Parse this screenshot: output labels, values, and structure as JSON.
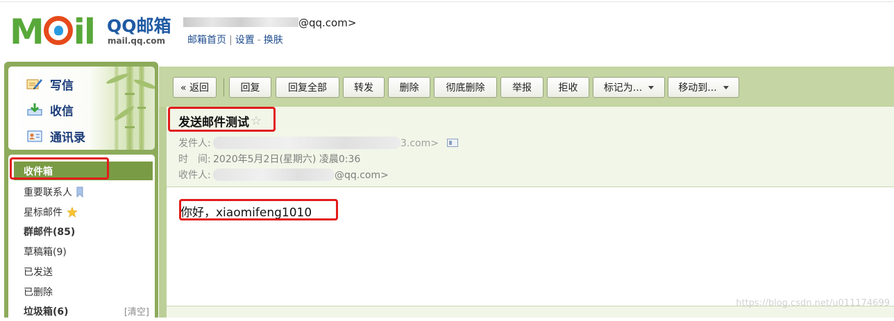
{
  "header": {
    "logo_text": "MOil",
    "product_name": "QQ邮箱",
    "domain": "mail.qq.com",
    "user_email_suffix": "@qq.com>",
    "links": [
      "邮箱首页",
      "设置",
      "换肤"
    ]
  },
  "sidebar": {
    "quick_actions": [
      {
        "label": "写信",
        "icon": "compose-icon"
      },
      {
        "label": "收信",
        "icon": "receive-icon"
      },
      {
        "label": "通讯录",
        "icon": "contacts-icon"
      }
    ],
    "folders": [
      {
        "label": "收件箱",
        "active": true
      },
      {
        "label": "重要联系人",
        "icon": "bookmark-icon"
      },
      {
        "label": "星标邮件",
        "icon": "star-icon"
      },
      {
        "label": "群邮件(85)",
        "bold": true
      },
      {
        "label": "草稿箱(9)"
      },
      {
        "label": "已发送"
      },
      {
        "label": "已删除"
      },
      {
        "label": "垃圾箱(6)",
        "bold": true,
        "action": "[清空]"
      }
    ]
  },
  "toolbar": {
    "buttons": [
      "« 返回",
      "回复",
      "回复全部",
      "转发",
      "删除",
      "彻底删除",
      "举报",
      "拒收",
      "标记为...",
      "移动到..."
    ]
  },
  "mail": {
    "subject": "发送邮件测试",
    "from_label": "发件人:",
    "from_value_suffix": "3.com>",
    "time_label": "时　间:",
    "time_value": "2020年5月2日(星期六) 凌晨0:36",
    "to_label": "收件人:",
    "to_value_suffix": "@qq.com>",
    "body": "你好，xiaomifeng1010"
  },
  "watermark": "https://blog.csdn.net/u011174699",
  "colors": {
    "sidebar_green": "#8dab5b",
    "active_folder": "#7a9b45",
    "toolbar_bg": "#c5d5a3",
    "annotation_red": "#e21b1b",
    "link_blue": "#1f4c8f"
  }
}
